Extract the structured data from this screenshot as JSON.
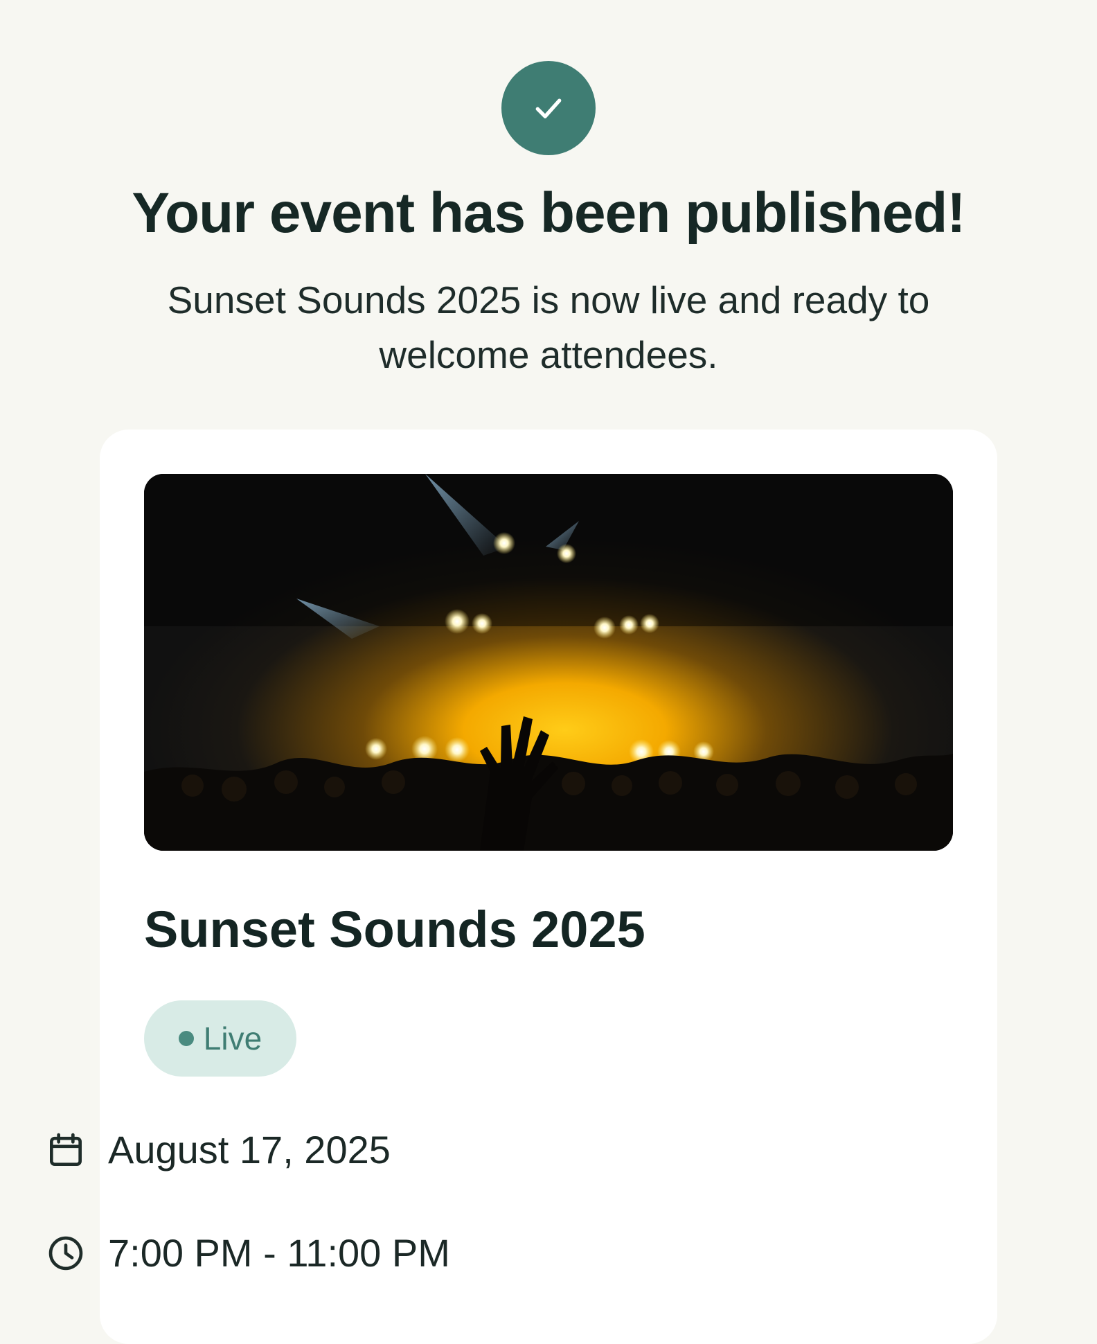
{
  "confirmation": {
    "icon": "check-icon",
    "headline": "Your event has been published!",
    "message": "Sunset Sounds 2025 is now live and ready to welcome attendees."
  },
  "event": {
    "image": "concert-crowd-stage-lights-image",
    "title": "Sunset Sounds 2025",
    "status": "Live",
    "date": "August 17, 2025",
    "time": "7:00 PM - 11:00 PM",
    "date_icon": "calendar-icon",
    "time_icon": "clock-icon"
  },
  "colors": {
    "background": "#f7f7f2",
    "accent": "#3f7d73",
    "badge_background": "#d8ebe6",
    "text": "#142523"
  }
}
